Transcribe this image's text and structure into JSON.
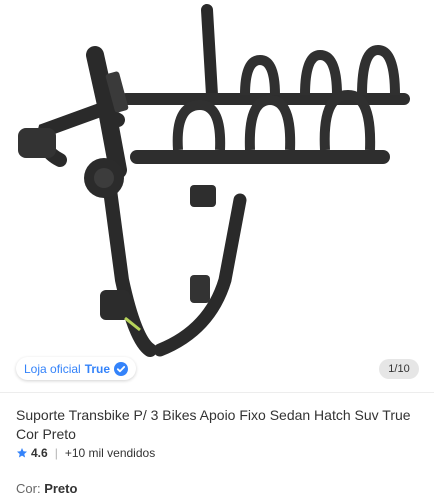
{
  "gallery": {
    "store_prefix": "Loja oficial",
    "store_name": "True",
    "image_counter": "1/10",
    "verified_icon": "verified-check-icon"
  },
  "product": {
    "title": "Suporte Transbike P/ 3 Bikes Apoio Fixo Sedan Hatch Suv True Cor Preto",
    "rating": "4.6",
    "separator": "|",
    "sold": "+10 mil vendidos"
  },
  "variant": {
    "label": "Cor:",
    "value": "Preto"
  },
  "colors": {
    "accent": "#3483fa",
    "text": "#333333",
    "muted": "#666666"
  }
}
